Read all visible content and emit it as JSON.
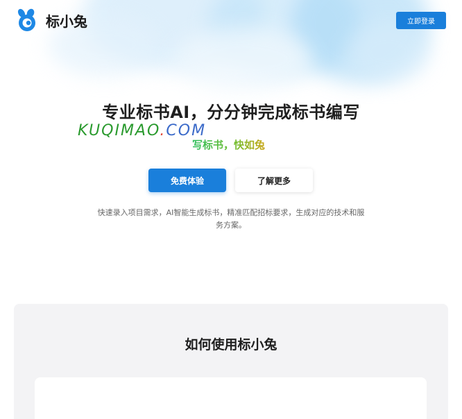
{
  "header": {
    "brand": "标小兔",
    "login_label": "立即登录"
  },
  "hero": {
    "title": "专业标书AI，分分钟完成标书编写",
    "watermark_main": "KUQIMAO",
    "watermark_dot": ".",
    "watermark_tail": "COM",
    "slogan": "写标书，快如兔",
    "primary_cta": "免费体验",
    "secondary_cta": "了解更多",
    "description": "快速录入项目需求，AI智能生成标书，精准匹配招标要求，生成对应的技术和服务方案。"
  },
  "howto": {
    "title": "如何使用标小兔"
  },
  "colors": {
    "brand_blue": "#1a7fdb",
    "logo_blue": "#1e88e5",
    "page_bg": "#ffffff",
    "section_bg": "#f3f3f5"
  },
  "icons": {
    "logo": "rabbit-logo-icon"
  }
}
